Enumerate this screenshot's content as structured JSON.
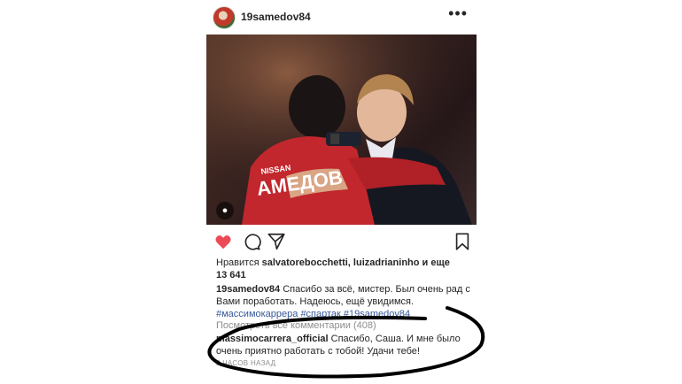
{
  "post": {
    "username": "19samedov84",
    "more_icon": "ellipsis-icon",
    "photo": {
      "jersey_text": "АМЕДОВ",
      "sponsor_text": "NISSAN",
      "tag_icon": "person-tag-icon"
    },
    "actions": {
      "like_icon": "heart-icon",
      "comment_icon": "comment-icon",
      "share_icon": "share-icon",
      "save_icon": "bookmark-icon",
      "liked": true,
      "like_color": "#ed4956"
    },
    "likes": {
      "prefix": "Нравится ",
      "users": "salvatorebocchetti, luizadrianinho",
      "and_more": " и еще",
      "count": "13 641"
    },
    "caption": {
      "username": "19samedov84",
      "text": " Спасибо за всё, мистер. Был очень рад с Вами поработать. Надеюсь, ещё увидимся.",
      "hashtags": "#массимокаррера #спартак #19samedov84"
    },
    "view_all_comments": "Посмотреть все комментарии (408)",
    "comment": {
      "username": "massimocarrera_official",
      "text": " Спасибо, Саша. И мне было очень приятно работать с тобой! Удачи тебе!"
    },
    "timestamp": "2 ЧАСОВ НАЗАД"
  }
}
